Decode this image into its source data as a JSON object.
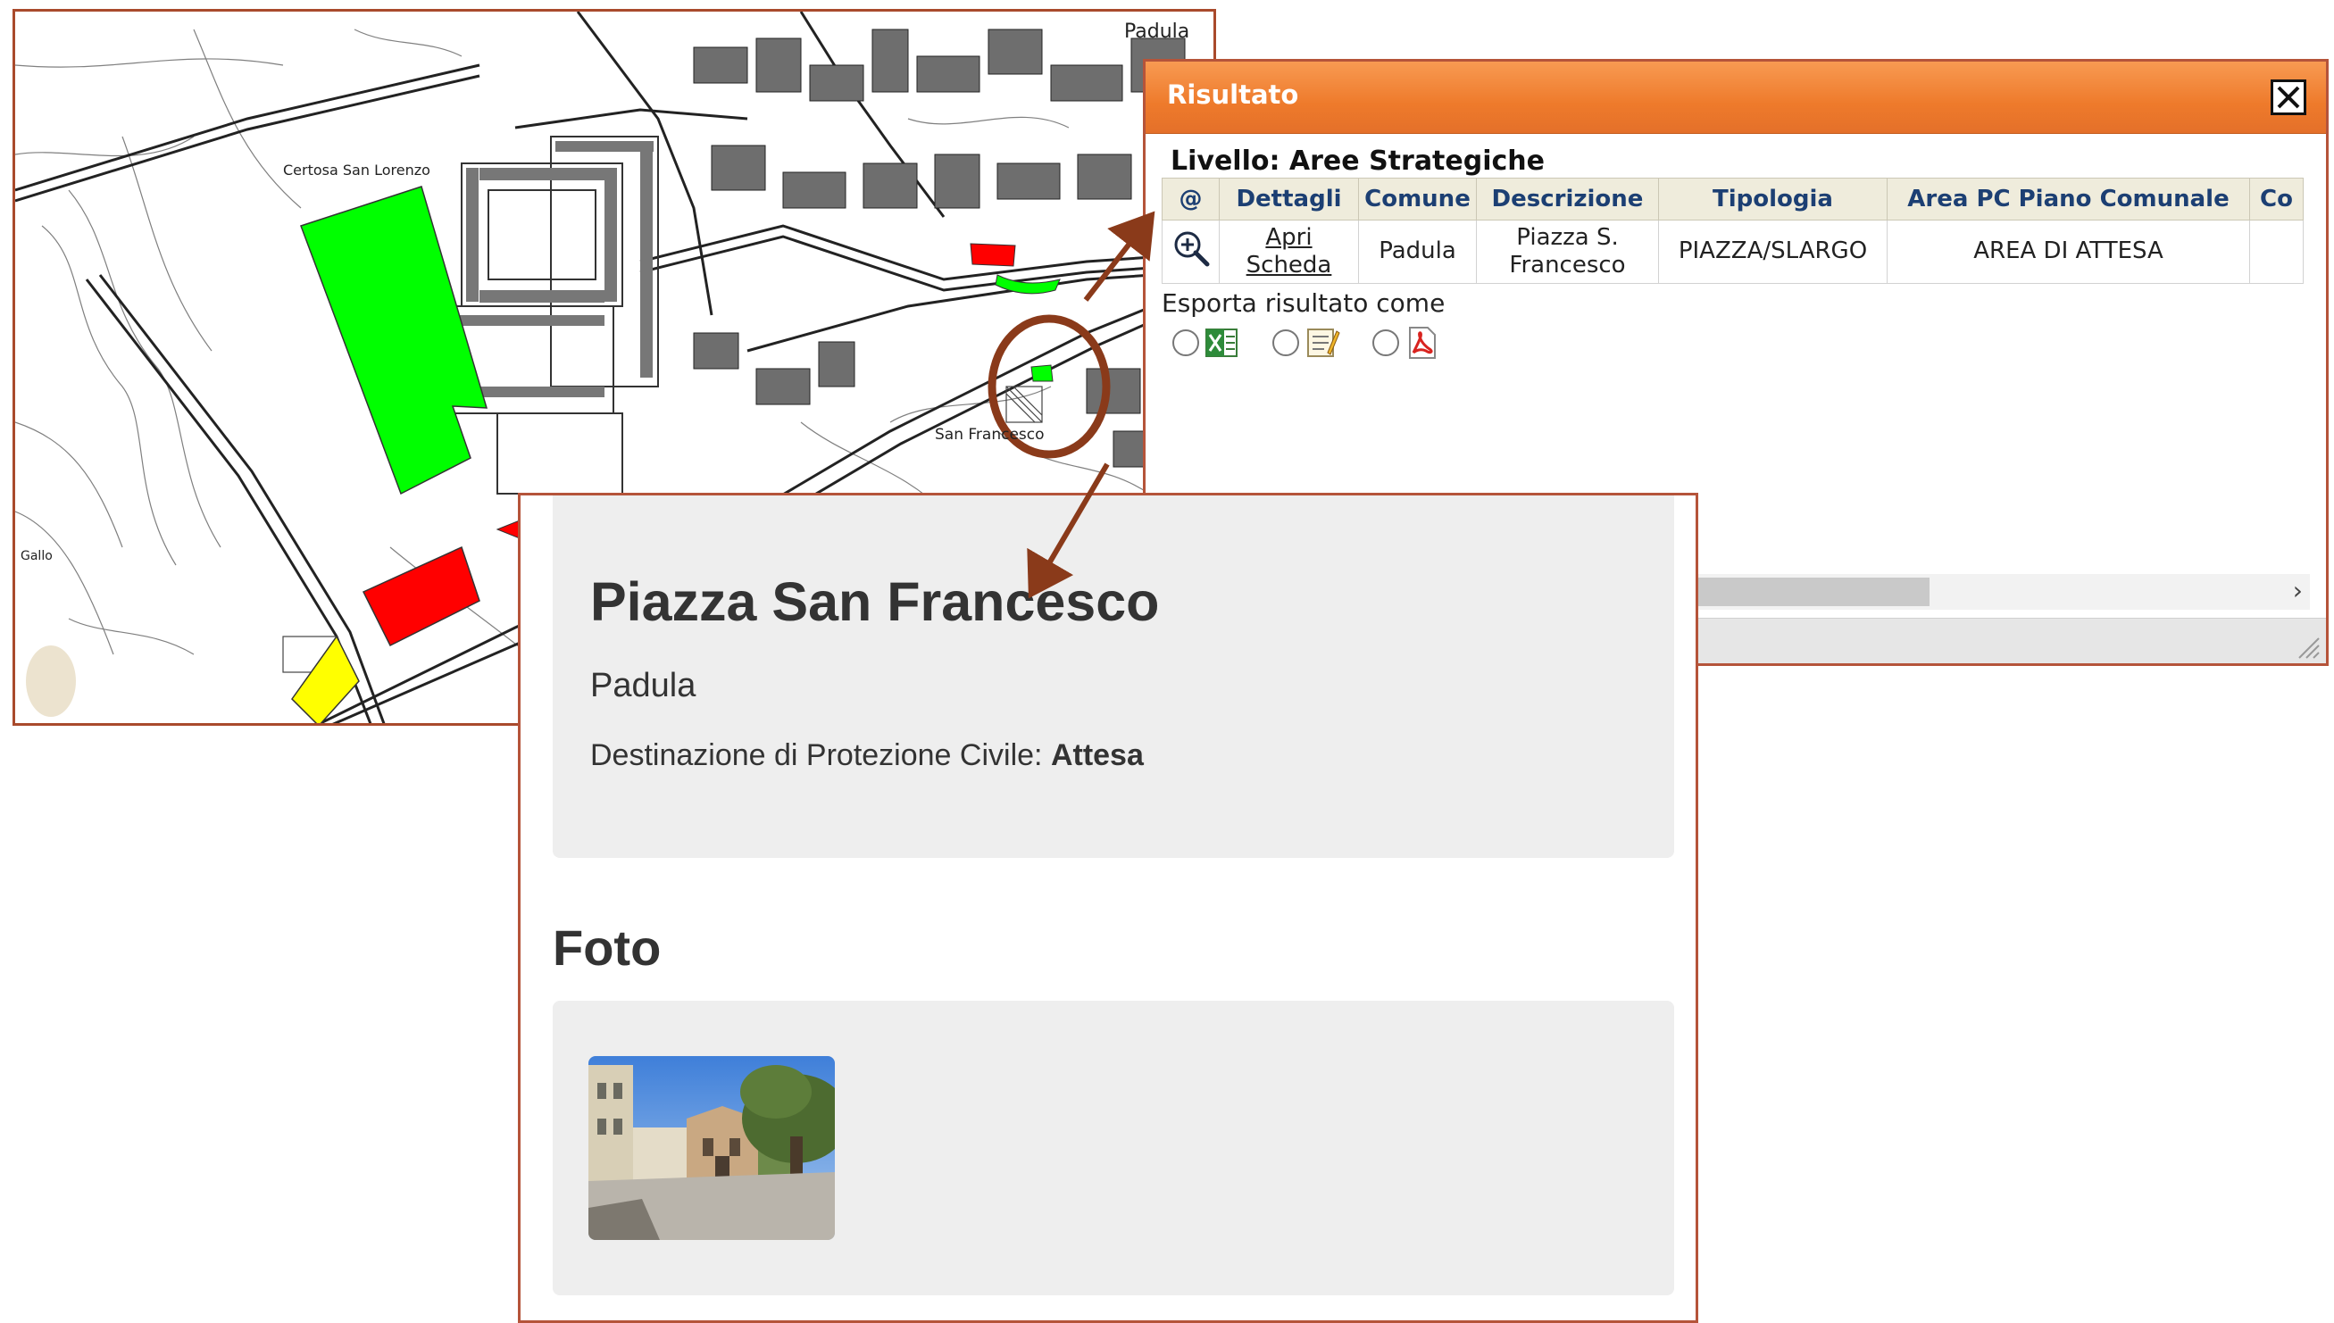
{
  "map": {
    "labels": {
      "padula": "Padula",
      "certosa": "Certosa San Lorenzo",
      "san_francesco": "San Francesco",
      "gallo": "Gallo"
    },
    "colors": {
      "green_area": "#00ff00",
      "red_area": "#ff0000",
      "yellow_area": "#ffff00",
      "highlight_circle": "#8a3a1a"
    }
  },
  "result_window": {
    "title": "Risultato",
    "close_icon": "close-icon",
    "level_label": "Livello: Aree Strategiche",
    "table": {
      "headers": [
        "@",
        "Dettagli",
        "Comune",
        "Descrizione",
        "Tipologia",
        "Area PC Piano Comunale",
        "Co"
      ],
      "rows": [
        {
          "zoom_icon": "zoom-in-icon",
          "dettagli_line1": "Apri",
          "dettagli_line2": "Scheda",
          "comune": "Padula",
          "descrizione_line1": "Piazza S.",
          "descrizione_line2": "Francesco",
          "tipologia": "PIAZZA/SLARGO",
          "area_pc": "AREA DI ATTESA"
        }
      ]
    },
    "export_label": "Esporta risultato come",
    "export_options": [
      "excel-icon",
      "text-icon",
      "pdf-icon"
    ],
    "scroll_arrow": "›",
    "colors": {
      "title_bar": "#ef7d2e",
      "header_text": "#1c3f73",
      "header_bg": "#efecdc"
    }
  },
  "detail": {
    "title": "Piazza San Francesco",
    "comune": "Padula",
    "destinazione_label": "Destinazione di Protezione Civile:",
    "destinazione_value": "Attesa",
    "foto_heading": "Foto"
  },
  "annotation": {
    "arrow_color": "#8a3a1a"
  }
}
